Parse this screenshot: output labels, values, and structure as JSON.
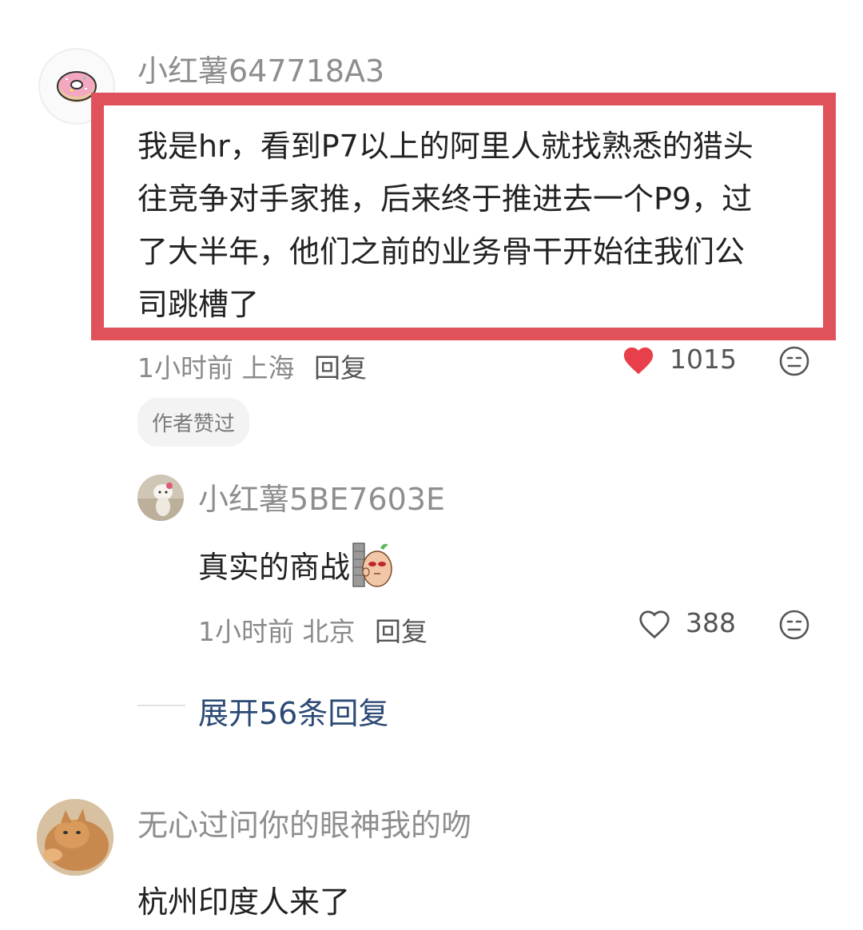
{
  "comments": [
    {
      "username": "小红薯647718A3",
      "text_lines": [
        "我是hr，看到P7以上的阿里人就找熟悉的猎头",
        "往竞争对手家推，后来终于推进去一个P9，过",
        "了大半年，他们之前的业务骨干开始往我们公",
        "司跳槽了"
      ],
      "time": "1小时前",
      "location": "上海",
      "reply_label": "回复",
      "likes": "1015",
      "liked": true,
      "badge": "作者赞过",
      "avatar_icon": "donut-icon"
    }
  ],
  "reply": {
    "username": "小红薯5BE7603E",
    "text": "真实的商战",
    "sticker_icon": "potato-wall-sticker-icon",
    "time": "1小时前",
    "location": "北京",
    "reply_label": "回复",
    "likes": "388",
    "liked": false
  },
  "expand_label": "展开56条回复",
  "comment2": {
    "username": "无心过问你的眼神我的吻",
    "text": "杭州印度人来了",
    "avatar_icon": "cat-icon"
  },
  "colors": {
    "highlight_border": "#e0525b",
    "like_red": "#e8404a",
    "expand_blue": "#2c4a75"
  }
}
